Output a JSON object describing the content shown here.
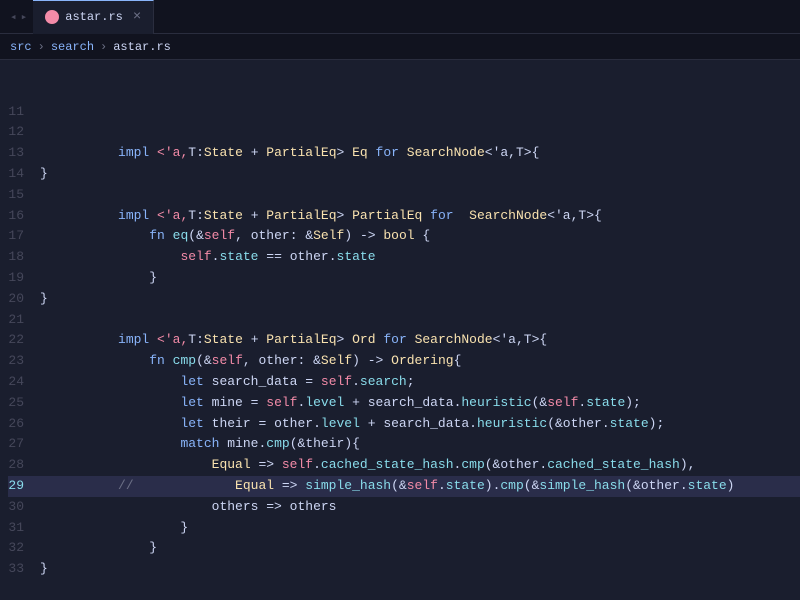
{
  "tab": {
    "label": "astar.rs",
    "close": "×"
  },
  "breadcrumb": {
    "items": [
      "src",
      "search",
      "astar.rs"
    ]
  },
  "lines": [
    {
      "num": "11",
      "content": []
    },
    {
      "num": "12",
      "content": []
    },
    {
      "num": "13",
      "content": "impl_line_13"
    },
    {
      "num": "14",
      "content": []
    },
    {
      "num": "15",
      "content": []
    },
    {
      "num": "16",
      "content": "impl_line_16"
    },
    {
      "num": "17",
      "content": "fn_eq"
    },
    {
      "num": "18",
      "content": "self_state"
    },
    {
      "num": "19",
      "content": "close_brace_indent1"
    },
    {
      "num": "20",
      "content": "close_brace"
    },
    {
      "num": "21",
      "content": []
    },
    {
      "num": "22",
      "content": "impl_line_22"
    },
    {
      "num": "23",
      "content": "fn_cmp"
    },
    {
      "num": "24",
      "content": "let_search_data"
    },
    {
      "num": "25",
      "content": "let_mine"
    },
    {
      "num": "26",
      "content": "let_their"
    },
    {
      "num": "27",
      "content": "match_mine"
    },
    {
      "num": "28",
      "content": "equal_cached"
    },
    {
      "num": "29",
      "content": "comment_equal_simple"
    },
    {
      "num": "30",
      "content": "others"
    },
    {
      "num": "31",
      "content": "close_brace_indent2"
    },
    {
      "num": "32",
      "content": "close_brace_indent1b"
    },
    {
      "num": "33",
      "content": "close_brace"
    }
  ]
}
